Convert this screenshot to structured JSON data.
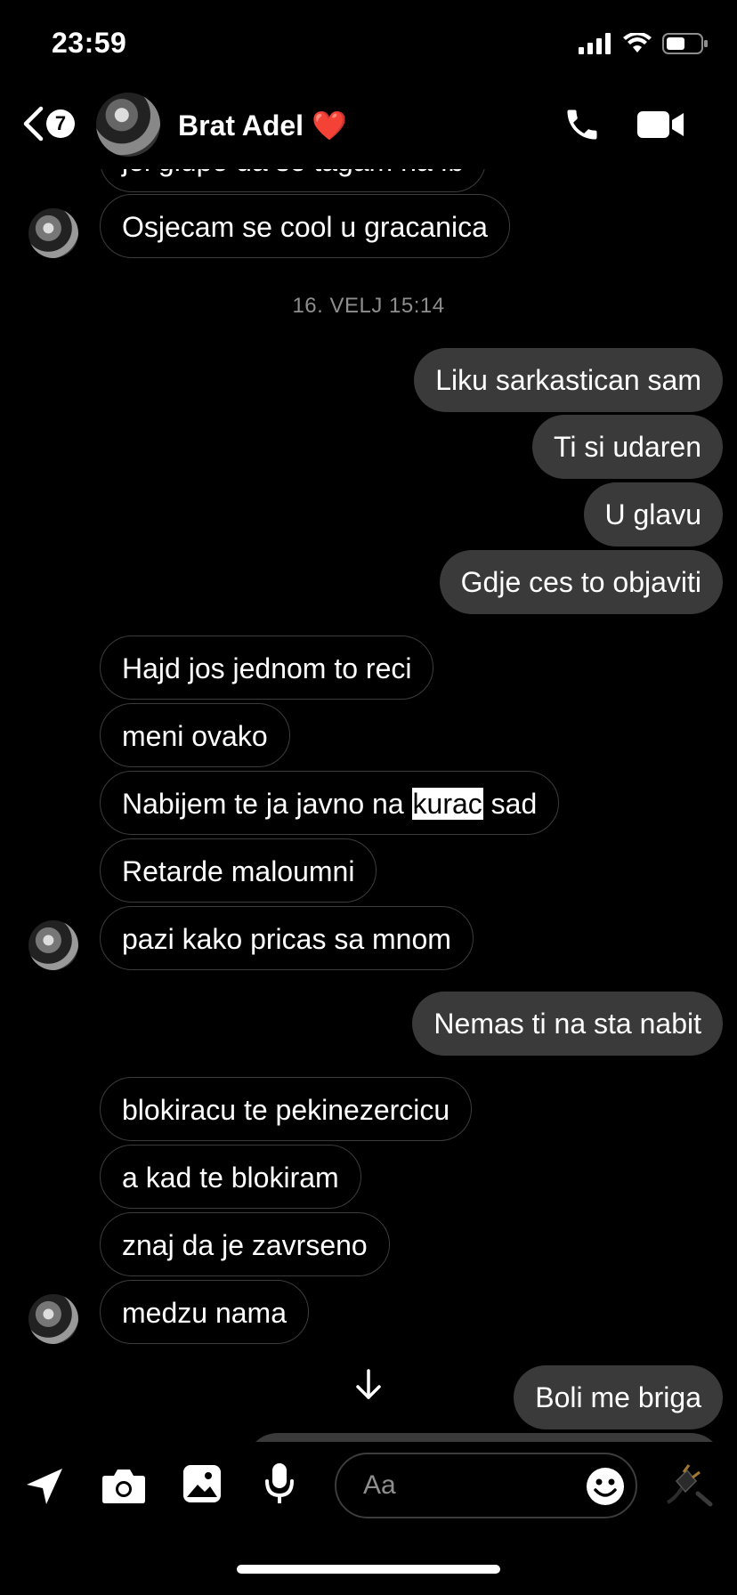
{
  "status": {
    "time": "23:59"
  },
  "header": {
    "back_count": "7",
    "name": "Brat Adel",
    "heart": "❤️"
  },
  "timestamp": "16. VELJ 15:14",
  "messages": [
    {
      "text": "jel glupo da se tagam na fb"
    },
    {
      "text": "Osjecam se cool u gracanica"
    },
    {
      "text": "Liku sarkastican sam"
    },
    {
      "text": "Ti si udaren"
    },
    {
      "text": "U glavu"
    },
    {
      "text": "Gdje ces to objaviti"
    },
    {
      "text": "Hajd jos jednom to reci"
    },
    {
      "text": "meni ovako"
    },
    {
      "pre": "Nabijem te ja javno na ",
      "hl": "kurac",
      "post": " sad"
    },
    {
      "text": "Retarde maloumni"
    },
    {
      "text": "pazi kako pricas sa mnom"
    },
    {
      "text": "Nemas ti na sta nabit"
    },
    {
      "text": "blokiracu te pekinezercicu"
    },
    {
      "text": "a kad te blokiram"
    },
    {
      "text": "znaj da je zavrseno"
    },
    {
      "text": "medzu nama"
    },
    {
      "text": "Boli me briga"
    }
  ],
  "composer": {
    "placeholder": "Aa"
  },
  "colors": {
    "background": "#000000",
    "outgoing_bubble": "#3a3a3a",
    "incoming_border": "#3c3c3c",
    "timestamp": "#8e8e8e"
  }
}
